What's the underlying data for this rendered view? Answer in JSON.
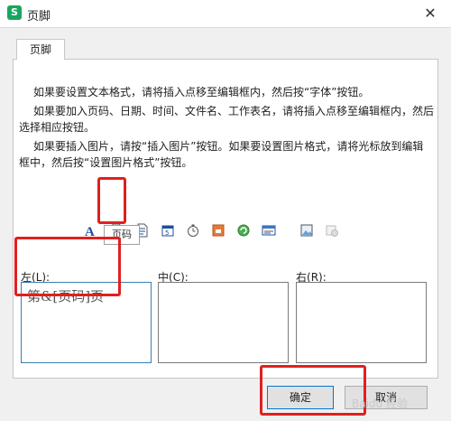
{
  "window": {
    "title": "页脚",
    "app_icon": "S",
    "close_glyph": "✕"
  },
  "tab": {
    "label": "页脚"
  },
  "instructions": [
    "如果要设置文本格式，请将插入点移至编辑框内，然后按“字体”按钮。",
    "如果要加入页码、日期、时间、文件名、工作表名，请将插入点移至编辑框内，然后选择相应按钮。",
    "如果要插入图片，请按“插入图片”按钮。如果要设置图片格式，请将光标放到编辑框中，然后按“设置图片格式”按钮。"
  ],
  "toolbar": {
    "icons": [
      "font-icon",
      "page-number-icon",
      "total-pages-icon",
      "date-icon",
      "time-icon",
      "file-path-icon",
      "filename-icon",
      "sheet-name-icon",
      "insert-picture-icon",
      "format-picture-icon"
    ],
    "tooltip": "页码"
  },
  "sections": {
    "left": {
      "label": "左(",
      "key": "L",
      "suffix": "):",
      "text": "第&[页码]页"
    },
    "center": {
      "label": "中(",
      "key": "C",
      "suffix": "):",
      "text": ""
    },
    "right": {
      "label": "右(",
      "key": "R",
      "suffix": "):",
      "text": ""
    }
  },
  "buttons": {
    "ok": "确定",
    "cancel": "取消"
  },
  "watermark": "Baidu 经验",
  "colors": {
    "highlight_red": "#e02020",
    "accent_blue": "#0078d7",
    "app_green": "#1aa55f"
  }
}
